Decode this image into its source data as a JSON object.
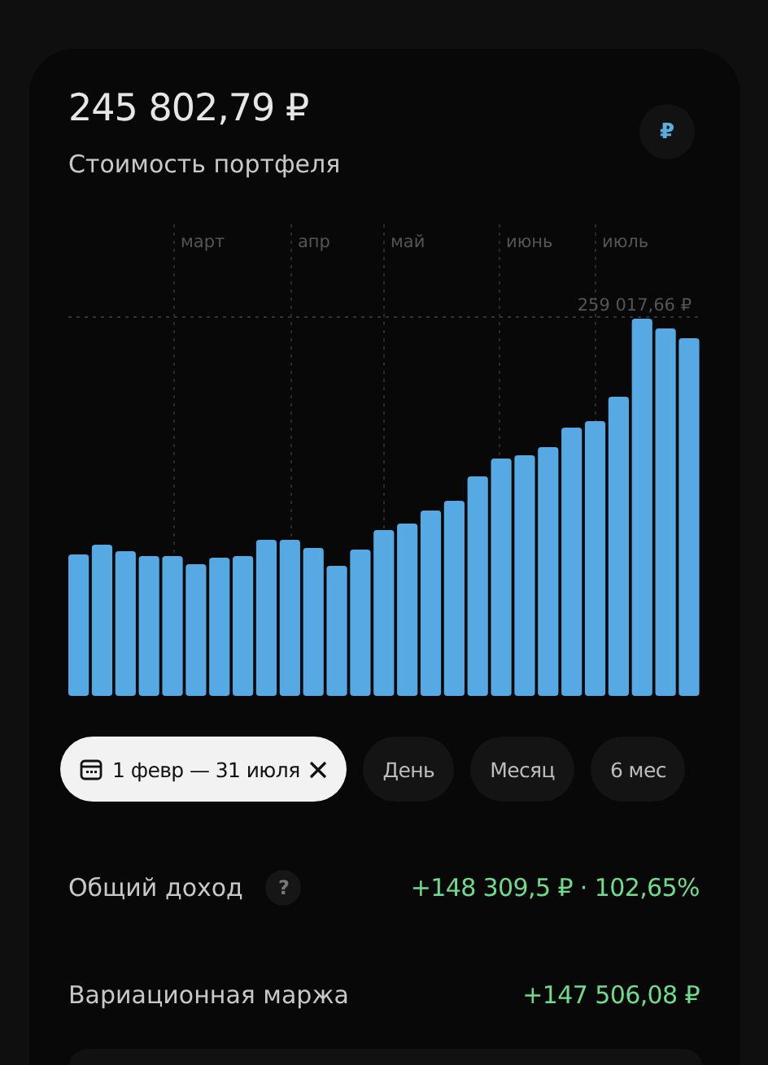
{
  "header": {
    "value": "245 802,79 ₽",
    "label": "Стоимость портфеля",
    "currency_button": "₽"
  },
  "chart": {
    "months": [
      "март",
      "апр",
      "май",
      "июнь",
      "июль"
    ],
    "max_label": "259 017,66 ₽"
  },
  "periods": [
    {
      "kind": "range",
      "label": "1 февр — 31 июля",
      "selected": true
    },
    {
      "kind": "preset",
      "label": "День",
      "selected": false
    },
    {
      "kind": "preset",
      "label": "Месяц",
      "selected": false
    },
    {
      "kind": "preset",
      "label": "6 мес",
      "selected": false
    }
  ],
  "metrics": [
    {
      "label": "Общий доход",
      "help": "?",
      "value": "+148 309,5 ₽ · 102,65%"
    },
    {
      "label": "Вариационная маржа",
      "value": "+147 506,08 ₽"
    }
  ]
}
